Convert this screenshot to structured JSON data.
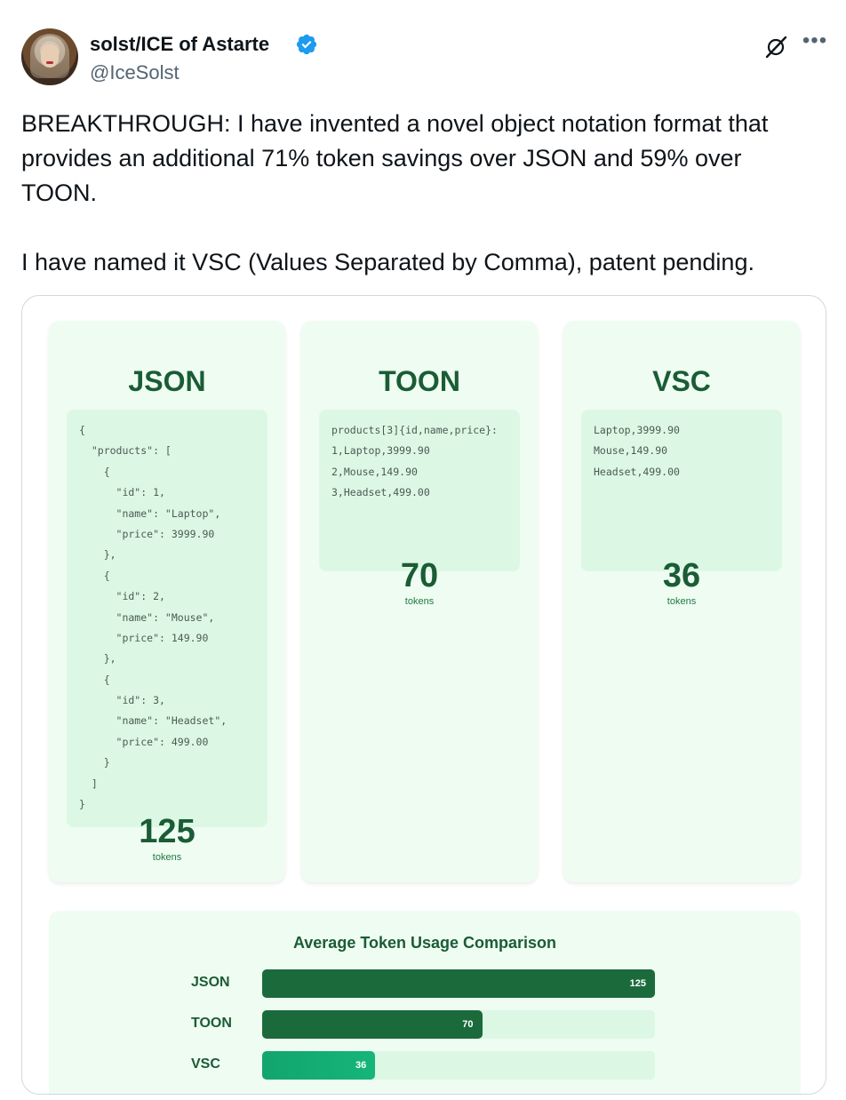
{
  "author": {
    "name": "solst/ICE of Astarte",
    "handle": "@IceSolst"
  },
  "icons": {
    "verified": "verified-badge-icon",
    "grok": "grok-icon",
    "more": "more-options-icon"
  },
  "tweet": {
    "text": "BREAKTHROUGH: I have invented a novel object notation format that provides an additional 71% token savings over JSON and 59% over TOON.\n\nI have named it VSC (Values Separated by Comma), patent pending."
  },
  "formats": [
    {
      "title": "JSON",
      "code": [
        "{",
        "  \"products\": [",
        "    {",
        "      \"id\": 1,",
        "      \"name\": \"Laptop\",",
        "      \"price\": 3999.90",
        "    },",
        "    {",
        "      \"id\": 2,",
        "      \"name\": \"Mouse\",",
        "      \"price\": 149.90",
        "    },",
        "    {",
        "      \"id\": 3,",
        "      \"name\": \"Headset\",",
        "      \"price\": 499.00",
        "    }",
        "  ]",
        "}"
      ],
      "tokens": "125",
      "unit": "tokens"
    },
    {
      "title": "TOON",
      "code": [
        "products[3]{id,name,price}:",
        "1,Laptop,3999.90",
        "2,Mouse,149.90",
        "3,Headset,499.00"
      ],
      "tokens": "70",
      "unit": "tokens"
    },
    {
      "title": "VSC",
      "code": [
        "Laptop,3999.90",
        "Mouse,149.90",
        "Headset,499.00"
      ],
      "tokens": "36",
      "unit": "tokens"
    }
  ],
  "chart_data": {
    "type": "bar",
    "orientation": "horizontal",
    "title": "Average Token Usage Comparison",
    "categories": [
      "JSON",
      "TOON",
      "VSC"
    ],
    "values": [
      125,
      70,
      36
    ],
    "data_labels": [
      "125",
      "70",
      "36"
    ],
    "xlim": [
      0,
      125
    ],
    "colors": [
      "#1b6a3b",
      "#1b6a3b",
      "#12a56c"
    ],
    "track_color": "#dcf8e4"
  }
}
